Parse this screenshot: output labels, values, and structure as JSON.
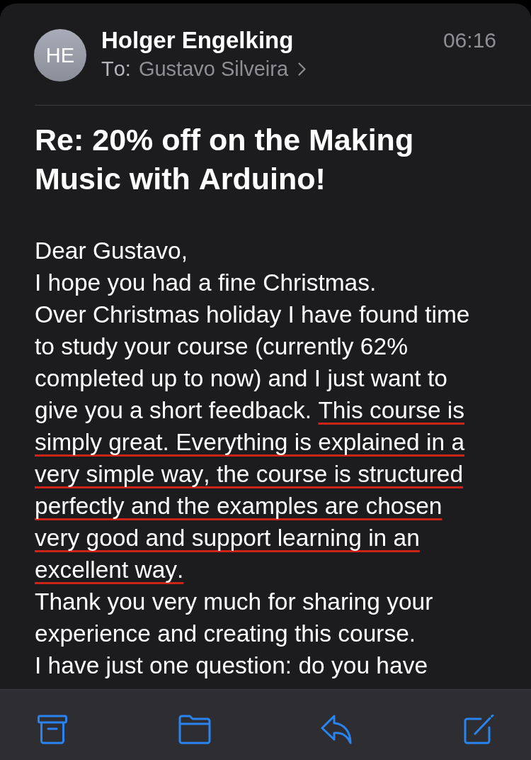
{
  "header": {
    "avatar_initials": "HE",
    "sender": "Holger Engelking",
    "time": "06:16",
    "to_label": "To:",
    "recipient": "Gustavo Silveira"
  },
  "subject": "Re: 20% off on the Making Music with Arduino!",
  "body": [
    {
      "segments": [
        {
          "text": "Dear Gustavo,",
          "underlined": false
        }
      ]
    },
    {
      "segments": [
        {
          "text": "I hope you had a fine Christmas.",
          "underlined": false
        }
      ]
    },
    {
      "segments": [
        {
          "text": "Over Christmas holiday I have found time to study your course (currently 62% completed up to now) and I just want to give you a short feedback. ",
          "underlined": false
        },
        {
          "text": "This course is simply great. Everything is explained in a very simple way, the course is structured perfectly and the examples are chosen very good and support learning in an excellent way.",
          "underlined": true
        }
      ]
    },
    {
      "segments": [
        {
          "text": "Thank you very much for sharing your experience and creating this course.",
          "underlined": false
        }
      ]
    },
    {
      "segments": [
        {
          "text": "I have just one question: do you have",
          "underlined": false
        }
      ]
    }
  ],
  "toolbar": {
    "buttons": [
      {
        "kind": "archive"
      },
      {
        "kind": "folder"
      },
      {
        "kind": "reply"
      },
      {
        "kind": "compose"
      }
    ]
  }
}
